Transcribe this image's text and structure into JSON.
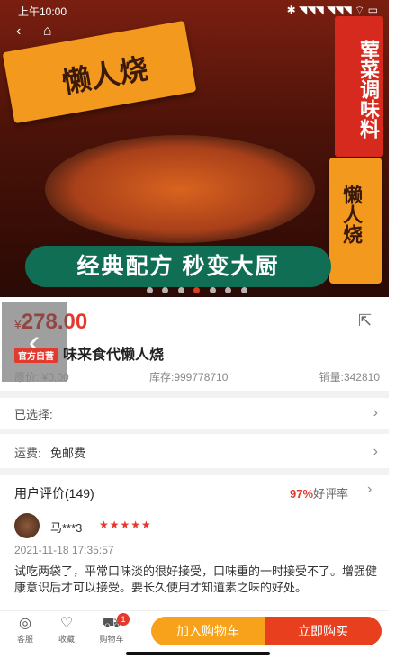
{
  "status": {
    "time": "上午10:00",
    "right": "✱ ◥◥◥ ◥◥◥ ⌔ ▭"
  },
  "banner": {
    "pack_brand": "懒人烧",
    "side_text": "荤菜调味料",
    "small_pack_brand": "懒人烧",
    "slogan": "经典配方 秒变大厨",
    "dots": 7,
    "active_dot": 3
  },
  "product": {
    "price_symbol": "¥",
    "price": "278.00",
    "tag": "官方自营",
    "title": "味来食代懒人烧",
    "original_price": "原价: ¥0.00",
    "stock": "库存:999778710",
    "sales": "销量:342810"
  },
  "rows": {
    "selected_label": "已选择:",
    "shipping_label": "运费:",
    "shipping_value": "免邮费"
  },
  "reviews": {
    "header": "用户评价(149)",
    "good_rate_pct": "97%",
    "good_rate_label": "好评率",
    "reviewer": "马***3",
    "stars": "★★★★★",
    "time": "2021-11-18 17:35:57",
    "text": "试吃两袋了，平常口味淡的很好接受，口味重的一时接受不了。增强健康意识后才可以接受。要长久使用才知道素之味的好处。"
  },
  "bottom": {
    "service": "客服",
    "favorite": "收藏",
    "cart": "购物车",
    "cart_count": "1",
    "add_cart": "加入购物车",
    "buy_now": "立即购买"
  }
}
